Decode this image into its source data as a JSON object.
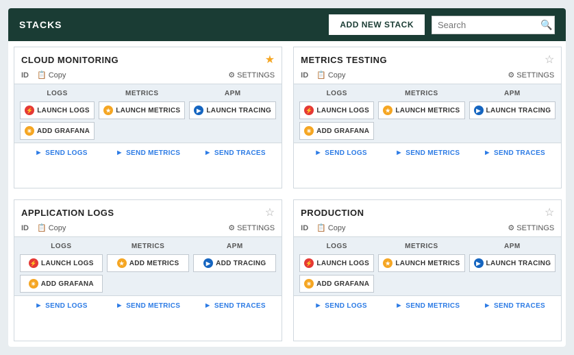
{
  "header": {
    "title": "STACKS",
    "add_btn_label": "ADD NEW STACK",
    "search_placeholder": "Search"
  },
  "stacks": [
    {
      "id": "cloud-monitoring",
      "name": "CLOUD MONITORING",
      "star": "filled",
      "id_label": "ID",
      "copy_label": "Copy",
      "settings_label": "SETTINGS",
      "services": {
        "logs": {
          "label": "LOGS",
          "buttons": [
            {
              "id": "launch-logs",
              "icon": "logs",
              "text": "LAUNCH LOGS"
            },
            {
              "id": "add-grafana",
              "icon": "grafana",
              "text": "ADD GRAFANA"
            }
          ]
        },
        "metrics": {
          "label": "METRICS",
          "buttons": [
            {
              "id": "launch-metrics",
              "icon": "metrics",
              "text": "LAUNCH METRICS"
            }
          ]
        },
        "apm": {
          "label": "APM",
          "buttons": [
            {
              "id": "launch-tracing",
              "icon": "tracing",
              "text": "LAUNCH TRACING"
            }
          ]
        }
      },
      "send": {
        "logs": "SEND LOGS",
        "metrics": "SEND METRICS",
        "traces": "SEND TRACES"
      }
    },
    {
      "id": "metrics-testing",
      "name": "METRICS TESTING",
      "star": "empty",
      "id_label": "ID",
      "copy_label": "Copy",
      "settings_label": "SETTINGS",
      "services": {
        "logs": {
          "label": "LOGS",
          "buttons": [
            {
              "id": "launch-logs",
              "icon": "logs",
              "text": "LAUNCH LOGS"
            },
            {
              "id": "add-grafana",
              "icon": "grafana",
              "text": "ADD GRAFANA"
            }
          ]
        },
        "metrics": {
          "label": "METRICS",
          "buttons": [
            {
              "id": "launch-metrics",
              "icon": "metrics",
              "text": "LAUNCH METRICS"
            }
          ]
        },
        "apm": {
          "label": "APM",
          "buttons": [
            {
              "id": "launch-tracing",
              "icon": "tracing",
              "text": "LAUNCH TRACING"
            }
          ]
        }
      },
      "send": {
        "logs": "SEND LOGS",
        "metrics": "SEND METRICS",
        "traces": "SEND TRACES"
      }
    },
    {
      "id": "application-logs",
      "name": "APPLICATION LOGS",
      "star": "empty",
      "id_label": "ID",
      "copy_label": "Copy",
      "settings_label": "SETTINGS",
      "services": {
        "logs": {
          "label": "LOGS",
          "buttons": [
            {
              "id": "launch-logs",
              "icon": "logs",
              "text": "LAUNCH LOGS"
            },
            {
              "id": "add-grafana",
              "icon": "grafana",
              "text": "ADD GRAFANA"
            }
          ]
        },
        "metrics": {
          "label": "METRICS",
          "buttons": [
            {
              "id": "add-metrics",
              "icon": "metrics",
              "text": "ADD METRICS"
            }
          ]
        },
        "apm": {
          "label": "APM",
          "buttons": [
            {
              "id": "add-tracing",
              "icon": "tracing",
              "text": "ADD TRACING"
            }
          ]
        }
      },
      "send": {
        "logs": "SEND LOGS",
        "metrics": "SEND METRICS",
        "traces": "SEND TRACES"
      }
    },
    {
      "id": "production",
      "name": "PRODUCTION",
      "star": "empty",
      "id_label": "ID",
      "copy_label": "Copy",
      "settings_label": "SETTINGS",
      "services": {
        "logs": {
          "label": "LOGS",
          "buttons": [
            {
              "id": "launch-logs",
              "icon": "logs",
              "text": "LAUNCH LOGS"
            },
            {
              "id": "add-grafana",
              "icon": "grafana",
              "text": "ADD GRAFANA"
            }
          ]
        },
        "metrics": {
          "label": "METRICS",
          "buttons": [
            {
              "id": "launch-metrics",
              "icon": "metrics",
              "text": "LAUNCH METRICS"
            }
          ]
        },
        "apm": {
          "label": "APM",
          "buttons": [
            {
              "id": "launch-tracing",
              "icon": "tracing",
              "text": "LAUNCH TRACING"
            }
          ]
        }
      },
      "send": {
        "logs": "SEND LOGS",
        "metrics": "SEND METRICS",
        "traces": "SEND TRACES"
      }
    }
  ]
}
